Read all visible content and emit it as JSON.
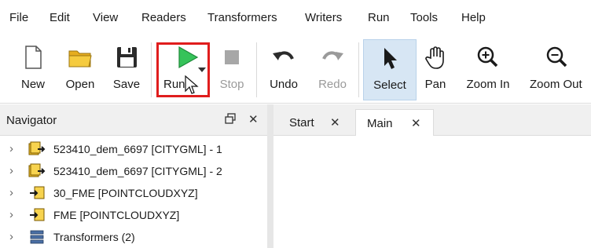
{
  "menu": [
    "File",
    "Edit",
    "View",
    "Readers",
    "Transformers",
    "Writers",
    "Run",
    "Tools",
    "Help"
  ],
  "toolbar": {
    "new": "New",
    "open": "Open",
    "save": "Save",
    "run": "Run",
    "stop": "Stop",
    "undo": "Undo",
    "redo": "Redo",
    "select": "Select",
    "pan": "Pan",
    "zoom_in": "Zoom In",
    "zoom_out": "Zoom Out"
  },
  "navigator": {
    "title": "Navigator",
    "float_icon": "restore-window-icon",
    "close_icon": "close-icon",
    "items": [
      {
        "label": "523410_dem_6697 [CITYGML] - 1",
        "icon": "reader-icon"
      },
      {
        "label": "523410_dem_6697 [CITYGML] - 2",
        "icon": "reader-icon"
      },
      {
        "label": "30_FME [POINTCLOUDXYZ]",
        "icon": "writer-icon"
      },
      {
        "label": "FME [POINTCLOUDXYZ]",
        "icon": "writer-icon"
      },
      {
        "label": "Transformers (2)",
        "icon": "transformers-icon"
      }
    ]
  },
  "tabs": [
    {
      "label": "Start"
    },
    {
      "label": "Main"
    }
  ],
  "colors": {
    "highlight": "#e01d1d",
    "run_green": "#2fb24a",
    "folder_yellow": "#f2c230",
    "active_tool_bg": "#d7e6f4"
  }
}
